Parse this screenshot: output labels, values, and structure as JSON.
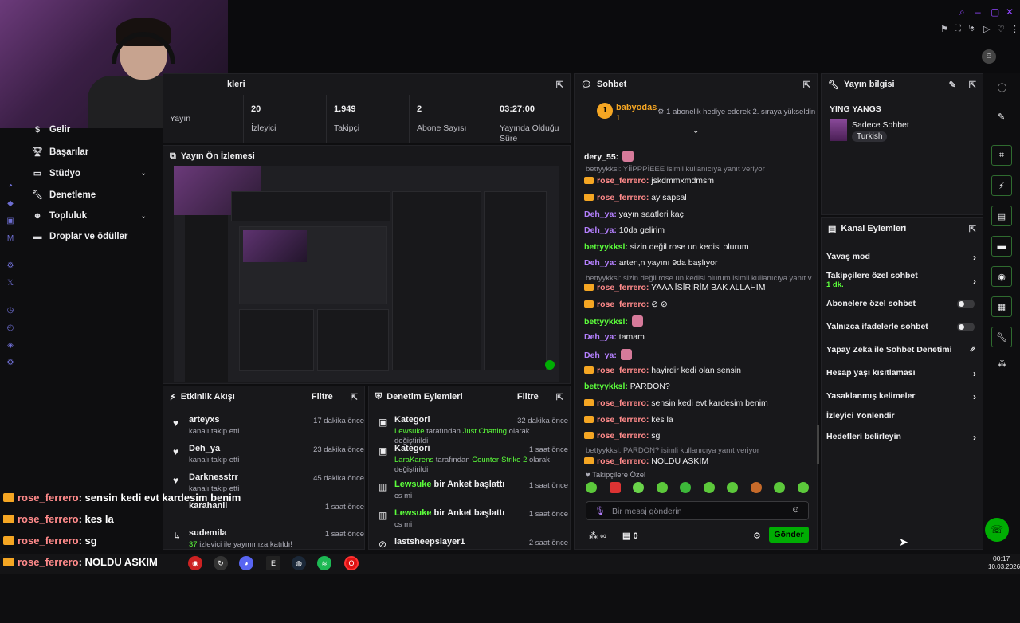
{
  "sidebar": {
    "items": [
      {
        "label": "Gelir",
        "icon": "revenue-icon"
      },
      {
        "label": "Başarılar",
        "icon": "trophy-icon"
      },
      {
        "label": "Stüdyo",
        "icon": "studio-icon"
      },
      {
        "label": "Denetleme",
        "icon": "wrench-icon"
      },
      {
        "label": "Topluluk",
        "icon": "community-icon"
      },
      {
        "label": "Droplar ve ödüller",
        "icon": "drops-icon"
      }
    ]
  },
  "stats_panel": {
    "title_partial": "kleri",
    "stats": [
      {
        "value": "",
        "label": "Yayın"
      },
      {
        "value": "20",
        "label": "İzleyici"
      },
      {
        "value": "1.949",
        "label": "Takipçi"
      },
      {
        "value": "2",
        "label": "Abone Sayısı"
      },
      {
        "value": "03:27:00",
        "label": "Yayında Olduğu Süre"
      }
    ]
  },
  "preview": {
    "title": "Yayın Ön İzlemesi"
  },
  "activity": {
    "title": "Etkinlik Akışı",
    "filter": "Filtre",
    "items": [
      {
        "name": "arteyxs",
        "sub": "kanalı takip etti",
        "time": "17 dakika önce"
      },
      {
        "name": "Deh_ya",
        "sub": "kanalı takip etti",
        "time": "23 dakika önce"
      },
      {
        "name": "Darknesstrr",
        "sub": "kanalı takip etti",
        "time": "45 dakika önce"
      },
      {
        "name": "karahanli",
        "sub": "",
        "time": "1 saat önce"
      },
      {
        "name": "sudemila",
        "sub_count": "37",
        "sub": "izlevici ile yayınınıza katıldı!",
        "time": "1 saat önce"
      }
    ]
  },
  "mod": {
    "title": "Denetim Eylemleri",
    "filter": "Filtre",
    "items": [
      {
        "title": "Kategori",
        "user": "Lewsuke",
        "mid": "tarafından",
        "cat": "Just Chatting",
        "tail": "olarak değiştirildi",
        "time": "32 dakika önce"
      },
      {
        "title": "Kategori",
        "user": "LaraKarens",
        "mid": "tarafından",
        "cat": "Counter-Strike 2",
        "tail": "olarak değiştirildi",
        "time": "1 saat önce"
      },
      {
        "user": "Lewsuke",
        "title": "bir Anket başlattı",
        "sub": "cs mi",
        "time": "1 saat önce"
      },
      {
        "user": "Lewsuke",
        "title": "bir Anket başlattı",
        "sub": "cs mi",
        "time": "1 saat önce"
      },
      {
        "title": "lastsheepslayer1",
        "time": "2 saat önce"
      }
    ]
  },
  "chat": {
    "title": "Sohbet",
    "pinned_user": "babyodas",
    "pinned_count": "1",
    "pinned_msg": "1 abonelik hediye ederek 2. sıraya yükseldin",
    "lines": [
      {
        "user": "dery_55:",
        "msg": "",
        "color": "#efeff1",
        "crown": false
      },
      {
        "reply": "bettyykksl: YİİPPPİEEE isimli kullanıcıya yanıt veriyor"
      },
      {
        "user": "rose_ferrero:",
        "msg": "jskdmmxmdmsm",
        "color": "#ff8a8a",
        "crown": true
      },
      {
        "user": "rose_ferrero:",
        "msg": "ay sapsal",
        "color": "#ff8a8a",
        "crown": true
      },
      {
        "user": "Deh_ya:",
        "msg": "yayın saatleri kaç",
        "color": "#b580ff",
        "crown": false
      },
      {
        "user": "Deh_ya:",
        "msg": "10da gelirim",
        "color": "#b580ff",
        "crown": false
      },
      {
        "user": "bettyykksl:",
        "msg": "sizin değil rose un kedisi olurum",
        "color": "#5cff3b",
        "crown": false
      },
      {
        "user": "Deh_ya:",
        "msg": "arten,n yayını 9da başlıyor",
        "color": "#b580ff",
        "crown": false
      },
      {
        "reply": "bettyykksl: sizin değil rose un kedisi olurum isimli kullanıcıya yanıt v..."
      },
      {
        "user": "rose_ferrero:",
        "msg": "YAAA İSİRİRİM BAK ALLAHIM",
        "color": "#ff8a8a",
        "crown": true
      },
      {
        "user": "rose_ferrero:",
        "msg": "⊘ ⊘",
        "color": "#ff8a8a",
        "crown": true
      },
      {
        "user": "bettyykksl:",
        "msg": "",
        "color": "#5cff3b",
        "crown": false
      },
      {
        "user": "Deh_ya:",
        "msg": "tamam",
        "color": "#b580ff",
        "crown": false
      },
      {
        "user": "Deh_ya:",
        "msg": "",
        "color": "#b580ff",
        "crown": false
      },
      {
        "user": "rose_ferrero:",
        "msg": "hayirdir kedi olan sensin",
        "color": "#ff8a8a",
        "crown": true
      },
      {
        "user": "bettyykksl:",
        "msg": "PARDON?",
        "color": "#5cff3b",
        "crown": false
      },
      {
        "user": "rose_ferrero:",
        "msg": "sensin kedi evt kardesim benim",
        "color": "#ff8a8a",
        "crown": true
      },
      {
        "user": "rose_ferrero:",
        "msg": "kes la",
        "color": "#ff8a8a",
        "crown": true
      },
      {
        "user": "rose_ferrero:",
        "msg": "sg",
        "color": "#ff8a8a",
        "crown": true
      },
      {
        "reply": "bettyykksl: PARDON? isimli kullanıcıya yanıt veriyor"
      },
      {
        "user": "rose_ferrero:",
        "msg": "NOLDU ASKIM",
        "color": "#ff8a8a",
        "crown": true
      }
    ],
    "subs_only": "Takipçilere Özel",
    "input_placeholder": "Bir mesaj gönderin",
    "points": "∞",
    "gift_count": "0",
    "send": "Gönder"
  },
  "stream_info": {
    "title": "Yayın bilgisi",
    "stream_title": "YING YANGS",
    "category": "Sadece Sohbet",
    "tag": "Turkish"
  },
  "channel_actions": {
    "title": "Kanal Eylemleri",
    "items": [
      {
        "label": "Yavaş mod",
        "kind": "arrow"
      },
      {
        "label": "Takipçilere özel sohbet",
        "sub": "1 dk.",
        "kind": "arrow"
      },
      {
        "label": "Abonelere özel sohbet",
        "kind": "toggle"
      },
      {
        "label": "Yalnızca ifadelerle sohbet",
        "kind": "toggle"
      },
      {
        "label": "Yapay Zeka ile Sohbet Denetimi",
        "kind": "external"
      },
      {
        "label": "Hesap yaşı kısıtlaması",
        "kind": "arrow"
      },
      {
        "label": "Yasaklanmış kelimeler",
        "kind": "arrow"
      },
      {
        "label": "İzleyici Yönlendir",
        "kind": "none"
      },
      {
        "label": "Hedefleri belirleyin",
        "kind": "arrow"
      }
    ]
  },
  "overlay_chat": [
    {
      "user": "rose_ferrero",
      "msg": ": sensin kedi evt kardesim benim"
    },
    {
      "user": "rose_ferrero",
      "msg": ": kes la"
    },
    {
      "user": "rose_ferrero",
      "msg": ": sg"
    },
    {
      "user": "rose_ferrero",
      "msg": ": NOLDU ASKIM"
    }
  ],
  "clock": {
    "time": "00:17",
    "date": "10.03.2026"
  },
  "colors": {
    "accent": "#5cff3b",
    "background": "#0e0e10",
    "panel": "#18181b",
    "brand_purple": "#9147ff"
  }
}
